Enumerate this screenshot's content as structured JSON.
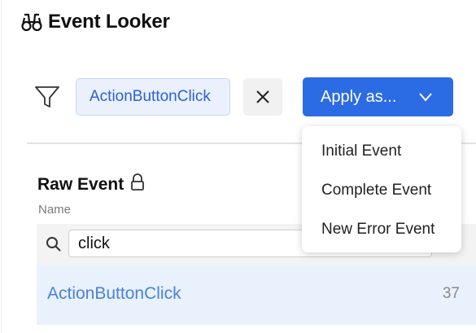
{
  "header": {
    "title": "Event Looker",
    "icon": "binoculars-icon"
  },
  "filter": {
    "icon": "filter-icon",
    "chip_label": "ActionButtonClick",
    "clear_icon": "close-icon",
    "apply_label": "Apply as...",
    "apply_icon": "chevron-down-icon"
  },
  "apply_menu": {
    "items": [
      "Initial Event",
      "Complete Event",
      "New Error Event"
    ]
  },
  "raw_event": {
    "title": "Raw Event",
    "lock_icon": "lock-icon",
    "column_header": "Name",
    "search": {
      "value": "click",
      "icon": "search-icon"
    },
    "rows": [
      {
        "name": "ActionButtonClick",
        "count": "37"
      }
    ]
  },
  "colors": {
    "accent": "#2b6be4",
    "chip_bg": "#eaf1fd",
    "chip_text": "#2a62d6",
    "row_selected_bg": "#e9f1fd",
    "row_text": "#4a82d9"
  }
}
